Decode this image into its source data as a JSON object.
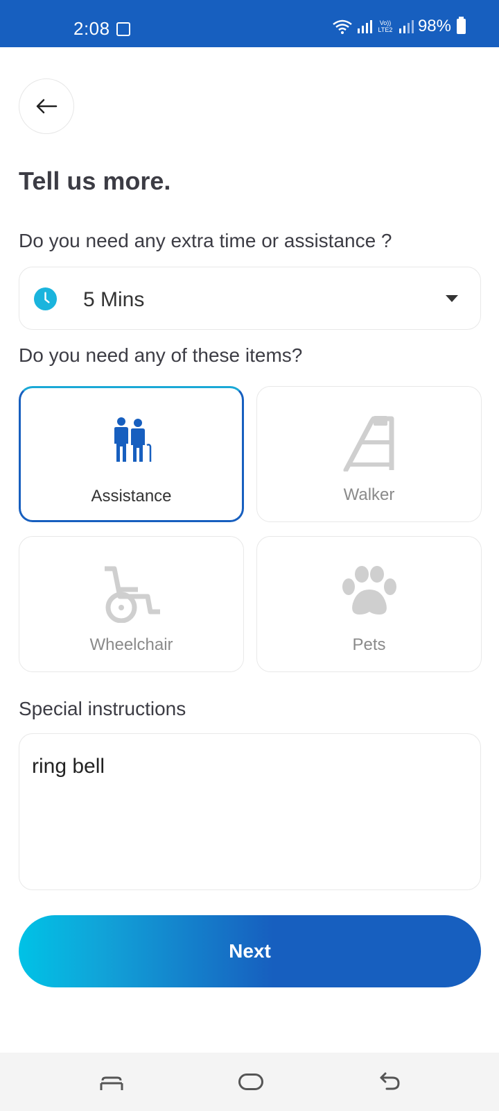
{
  "status_bar": {
    "time": "2:08",
    "network": "Vo)) LTE2",
    "battery": "98%"
  },
  "page": {
    "title": "Tell us more."
  },
  "extra_time": {
    "question": "Do you need any extra time or assistance ?",
    "selected": "5 Mins"
  },
  "items": {
    "question": "Do you need any of these items?",
    "options": [
      {
        "label": "Assistance",
        "selected": true
      },
      {
        "label": "Walker",
        "selected": false
      },
      {
        "label": "Wheelchair",
        "selected": false
      },
      {
        "label": "Pets",
        "selected": false
      }
    ]
  },
  "special_instructions": {
    "label": "Special instructions",
    "value": "ring bell"
  },
  "next_button": {
    "label": "Next"
  },
  "colors": {
    "primary": "#175fbf",
    "accent": "#00c2e6",
    "clock_icon": "#1ab4dd",
    "disabled_icon": "#cfcfcf"
  }
}
